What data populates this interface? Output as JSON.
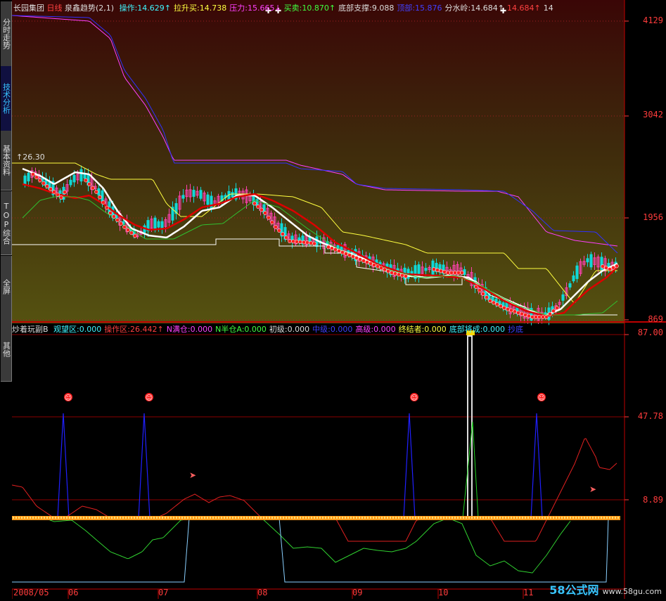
{
  "tabs": [
    {
      "label": "分时走势",
      "active": false
    },
    {
      "label": "技术分析",
      "active": true
    },
    {
      "label": "基本资料",
      "active": false
    },
    {
      "label": "TOP综合",
      "active": false
    },
    {
      "label": "全屏",
      "active": false
    },
    {
      "label": "其他",
      "active": false
    }
  ],
  "main_header": {
    "stock": "长园集团",
    "period": "日线",
    "indicator": "泉鑫趋势(2,1)",
    "items": [
      {
        "label": "操作:",
        "value": "14.629↑",
        "color": "#3ff5ff"
      },
      {
        "label": "拉升买:",
        "value": "14.738",
        "color": "#ffff40"
      },
      {
        "label": "压力:",
        "value": "15.665↓",
        "color": "#ff40ff"
      },
      {
        "label": "买卖:",
        "value": "10.870↑",
        "color": "#40ff40"
      },
      {
        "label": "底部支撑:",
        "value": "9.088",
        "color": "#dddddd"
      },
      {
        "label": "顶部:",
        "value": "15.876",
        "color": "#4040ff"
      },
      {
        "label": "分水岭:",
        "value": "14.684↑",
        "color": "#dddddd"
      },
      {
        "label": "",
        "value": "14.684↑",
        "color": "#ff4040"
      },
      {
        "label": "",
        "value": "14",
        "color": "#dddddd"
      }
    ],
    "peak_label": "26.30"
  },
  "main_axis": [
    "4129",
    "3042",
    "1956",
    "869"
  ],
  "sub_header": {
    "title": "炒着玩副B",
    "items": [
      {
        "label": "观望区:",
        "value": "0.000",
        "color": "#3ff5ff"
      },
      {
        "label": "操作区:",
        "value": "26.442↑",
        "color": "#ff4040"
      },
      {
        "label": "N满仓:",
        "value": "0.000",
        "color": "#ff40ff"
      },
      {
        "label": "N半仓A:",
        "value": "0.000",
        "color": "#40ff40"
      },
      {
        "label": "初级:",
        "value": "0.000",
        "color": "#dddddd"
      },
      {
        "label": "中级:",
        "value": "0.000",
        "color": "#4040ff"
      },
      {
        "label": "高级:",
        "value": "0.000",
        "color": "#ff40ff"
      },
      {
        "label": "终结者:",
        "value": "0.000",
        "color": "#ffff40"
      },
      {
        "label": "底部将成:",
        "value": "0.000",
        "color": "#3ff5ff"
      },
      {
        "label": "抄底",
        "value": "",
        "color": "#4040ff"
      }
    ]
  },
  "sub_axis": [
    "87.00",
    "47.78",
    "8.89"
  ],
  "dates": [
    "2008/05",
    "06",
    "07",
    "08",
    "09",
    "10",
    "11"
  ],
  "watermark": {
    "brand": "58公式网",
    "url": "www.58gu.com"
  },
  "colors": {
    "axis": "#ff3c3c",
    "grid": "#8b0000",
    "bg": "#000000"
  }
}
